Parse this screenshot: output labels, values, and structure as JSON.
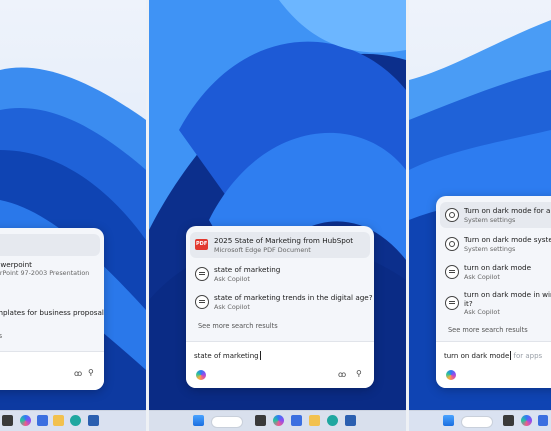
{
  "panels": {
    "left": {
      "results": [
        {
          "title": "owerpoint",
          "subtitle": "erPoint 97-2003 Presentation",
          "icon": "powerpoint-file-icon"
        },
        {
          "title": "mplates for business proposals",
          "subtitle": "",
          "icon": "document-icon"
        }
      ],
      "more_fragment": "ts",
      "icons": {
        "glasses": "glasses-icon",
        "mic": "microphone-icon"
      }
    },
    "middle": {
      "results": [
        {
          "title": "2025 State of Marketing from HubSpot",
          "subtitle": "Microsoft Edge PDF Document",
          "icon": "pdf-icon"
        },
        {
          "title": "state of marketing",
          "subtitle": "Ask Copilot",
          "icon": "copilot-chat-icon"
        },
        {
          "title": "state of marketing trends in the digital age?",
          "subtitle": "Ask Copilot",
          "icon": "copilot-chat-icon"
        }
      ],
      "see_more": "See more search results",
      "input_value": "state of marketing",
      "glasses_glyph": "6ò",
      "mic_glyph": "🎙"
    },
    "right": {
      "results": [
        {
          "title": "Turn on dark mode for apps",
          "subtitle": "System settings",
          "icon": "settings-icon"
        },
        {
          "title": "Turn on dark mode systemwide",
          "subtitle": "System settings",
          "icon": "settings-icon"
        },
        {
          "title": "turn on dark mode",
          "subtitle": "Ask Copilot",
          "icon": "copilot-chat-icon"
        },
        {
          "title": "turn on dark mode in windows.",
          "title2": "it?",
          "subtitle": "Ask Copilot",
          "icon": "copilot-chat-icon"
        }
      ],
      "see_more": "See more search results",
      "input_typed": "turn on dark mode",
      "input_suggestion": " for apps"
    }
  },
  "colors": {
    "accent": "#1f5fd6",
    "wallpaper_dark": "#0b2f8f",
    "wallpaper_light": "#4fa3ff"
  }
}
